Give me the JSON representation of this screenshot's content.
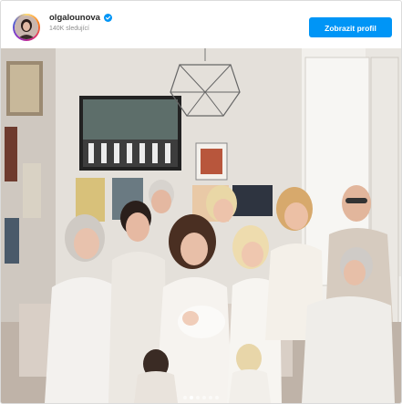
{
  "post": {
    "username": "olgalounova",
    "verified": true,
    "followers": "140K sledující",
    "profile_button_label": "Zobrazit profil"
  },
  "carousel": {
    "total": 6,
    "active_index": 1
  },
  "colors": {
    "accent": "#0095f6",
    "verified_badge": "#0095f6",
    "text_primary": "#262626",
    "text_secondary": "#8e8e8e"
  },
  "icons": {
    "verified": "verified-badge-icon",
    "carousel_dot": "carousel-dot-icon"
  }
}
